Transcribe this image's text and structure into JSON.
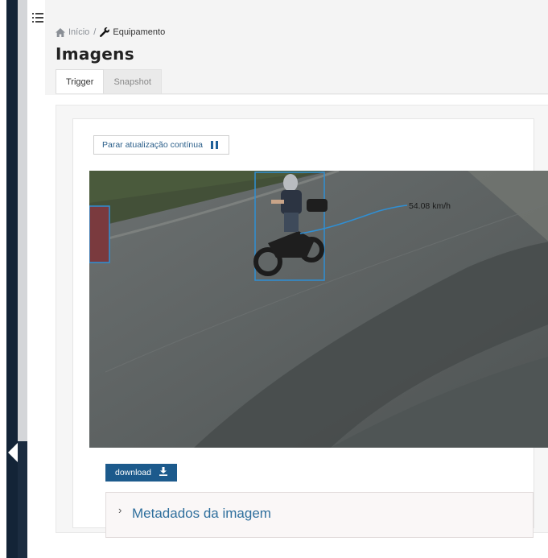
{
  "sidebar": {
    "toggle_icon": "list-icon",
    "collapse_icon": "chevron-left-icon"
  },
  "breadcrumb": {
    "home_label": "Início",
    "separator": "/",
    "current_label": "Equipamento"
  },
  "page": {
    "title": "Imagens"
  },
  "tabs": [
    {
      "label": "Trigger",
      "active": true
    },
    {
      "label": "Snapshot",
      "active": false
    }
  ],
  "toolbar": {
    "pause_label": "Parar atualização contínua",
    "pause_icon": "pause-icon"
  },
  "camera": {
    "speed_label": "54.08 km/h",
    "box_color": "#2f8fd4",
    "track_color": "#2f8fd4"
  },
  "actions": {
    "download_label": "download",
    "download_icon": "download-icon"
  },
  "metadata": {
    "label": "Metadados da imagem",
    "expanded": false
  },
  "colors": {
    "accent": "#1c5a8c",
    "sidebar": "#132437"
  }
}
